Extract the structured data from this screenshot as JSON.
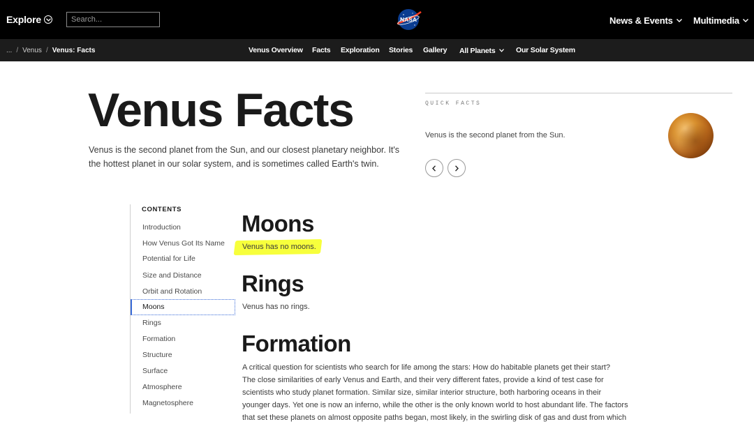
{
  "header": {
    "explore_label": "Explore",
    "search_placeholder": "Search...",
    "nav": [
      {
        "label": "News & Events"
      },
      {
        "label": "Multimedia"
      }
    ],
    "logo_text": "NASA"
  },
  "subnav": {
    "breadcrumb": [
      "...",
      "Venus",
      "Venus: Facts"
    ],
    "links": [
      {
        "label": "Venus Overview"
      },
      {
        "label": "Facts"
      },
      {
        "label": "Exploration"
      },
      {
        "label": "Stories"
      },
      {
        "label": "Gallery"
      },
      {
        "label": "All Planets"
      },
      {
        "label": "Our Solar System"
      }
    ]
  },
  "hero": {
    "title": "Venus Facts",
    "intro": "Venus is the second planet from the Sun, and our closest planetary neighbor. It's the hottest planet in our solar system, and is sometimes called Earth's twin."
  },
  "quick_facts": {
    "label": "QUICK FACTS",
    "text": "Venus is the second planet from the Sun."
  },
  "contents": {
    "heading": "CONTENTS",
    "items": [
      {
        "label": "Introduction"
      },
      {
        "label": "How Venus Got Its Name"
      },
      {
        "label": "Potential for Life"
      },
      {
        "label": "Size and Distance"
      },
      {
        "label": "Orbit and Rotation"
      },
      {
        "label": "Moons"
      },
      {
        "label": "Rings"
      },
      {
        "label": "Formation"
      },
      {
        "label": "Structure"
      },
      {
        "label": "Surface"
      },
      {
        "label": "Atmosphere"
      },
      {
        "label": "Magnetosphere"
      }
    ],
    "active": "Moons"
  },
  "article": {
    "moons_heading": "Moons",
    "moons_text": "Venus has no moons.",
    "rings_heading": "Rings",
    "rings_text": "Venus has no rings.",
    "formation_heading": "Formation",
    "formation_lines": [
      "A critical question for scientists who search for life among the stars: How do habitable planets get their start?",
      "The close similarities of early Venus and Earth, and their very different fates, provide a kind of test case for",
      "scientists who study planet formation. Similar size, similar interior structure, both harboring oceans in their",
      "younger days. Yet one is now an inferno, while the other is the only known world to host abundant life. The factors",
      "that set these planets on almost opposite paths began, most likely, in the swirling disk of gas and dust from which"
    ]
  },
  "colors": {
    "topbar": "#000000",
    "subbar": "#1c1c1c",
    "highlight": "#f7ff3c",
    "active_toc_border": "#3a6bd8"
  },
  "icons": {
    "explore_toggle": "chevron-circle-icon",
    "prev": "chevron-left-icon",
    "next": "chevron-right-icon",
    "dropdown": "chevron-down-icon"
  }
}
